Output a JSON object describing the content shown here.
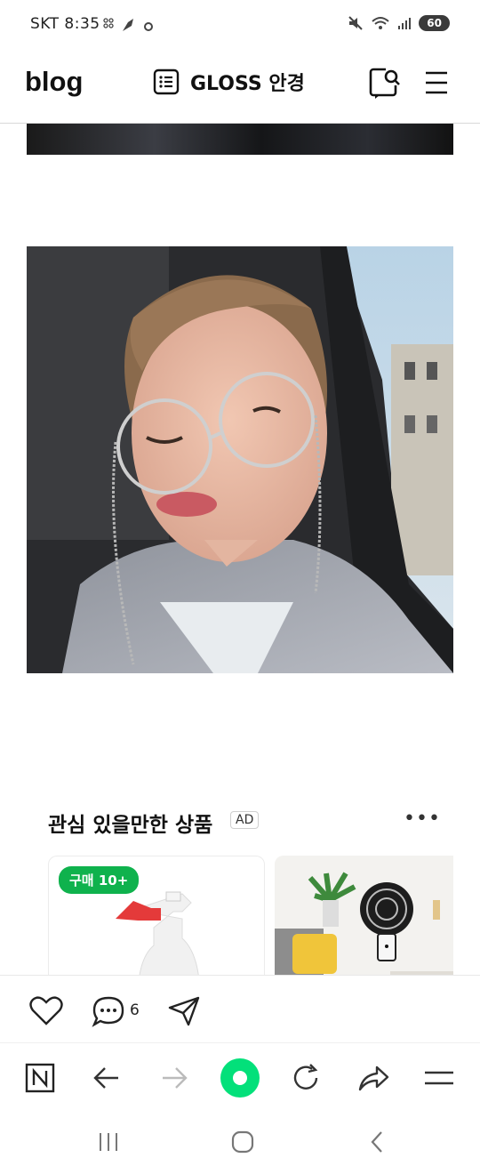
{
  "status_bar": {
    "carrier_time": "SKT 8:35",
    "battery": "60"
  },
  "header": {
    "logo": "blog",
    "title": "GLOSS 안경"
  },
  "ad": {
    "title": "관심 있을만한 상품",
    "badge": "AD",
    "more": "•••",
    "products": [
      {
        "badge": "구매 10+"
      },
      {
        "badge": ""
      }
    ]
  },
  "actions": {
    "comment_count": "6"
  },
  "icons": {
    "header": [
      "list-icon",
      "search-bubble-icon",
      "menu-icon"
    ],
    "actions": [
      "heart-icon",
      "comment-icon",
      "share-icon"
    ],
    "browser": [
      "naver-n-icon",
      "back-arrow-icon",
      "forward-arrow-icon",
      "green-dot-icon",
      "refresh-icon",
      "share-arrow-icon",
      "hamburger-icon"
    ],
    "system": [
      "recent-apps-icon",
      "home-icon",
      "back-icon"
    ]
  },
  "colors": {
    "brand_green": "#0fb24d",
    "accent_green": "#03e07a"
  }
}
